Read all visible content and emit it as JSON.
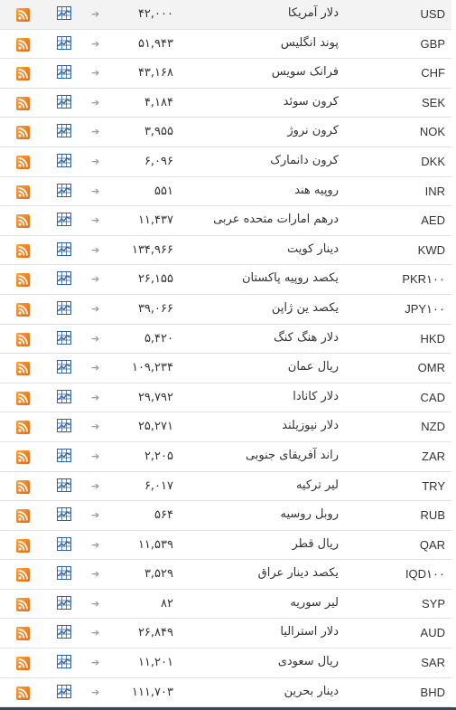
{
  "colors": {
    "rss": "#ef7d1d",
    "chart_icon": "#2f5f9e",
    "row_highlight": "#f3f3f3",
    "bottom_bar": "#3a4652"
  },
  "icons": {
    "rss": "rss-feed-icon",
    "chart": "chart-icon",
    "trend": "arrow-right-icon"
  },
  "trend_glyph": "➔",
  "rows": [
    {
      "code": "USD",
      "name": "دلار آمریکا",
      "value": "۴۲,۰۰۰"
    },
    {
      "code": "GBP",
      "name": "پوند انگلیس",
      "value": "۵۱,۹۴۳"
    },
    {
      "code": "CHF",
      "name": "فرانک سویس",
      "value": "۴۳,۱۶۸"
    },
    {
      "code": "SEK",
      "name": "کرون سوئد",
      "value": "۴,۱۸۴"
    },
    {
      "code": "NOK",
      "name": "کرون نروژ",
      "value": "۳,۹۵۵"
    },
    {
      "code": "DKK",
      "name": "کرون دانمارک",
      "value": "۶,۰۹۶"
    },
    {
      "code": "INR",
      "name": "روپیه هند",
      "value": "۵۵۱"
    },
    {
      "code": "AED",
      "name": "درهم امارات متحده عربی",
      "value": "۱۱,۴۳۷"
    },
    {
      "code": "KWD",
      "name": "دینار کویت",
      "value": "۱۳۴,۹۶۶"
    },
    {
      "code": "PKR۱۰۰",
      "name": "یکصد روپیه پاکستان",
      "value": "۲۶,۱۵۵"
    },
    {
      "code": "JPY۱۰۰",
      "name": "یکصد ین ژاپن",
      "value": "۳۹,۰۶۶"
    },
    {
      "code": "HKD",
      "name": "دلار هنگ کنگ",
      "value": "۵,۴۲۰"
    },
    {
      "code": "OMR",
      "name": "ریال عمان",
      "value": "۱۰۹,۲۳۴"
    },
    {
      "code": "CAD",
      "name": "دلار کانادا",
      "value": "۲۹,۷۹۲"
    },
    {
      "code": "NZD",
      "name": "دلار نیوزیلند",
      "value": "۲۵,۲۷۱"
    },
    {
      "code": "ZAR",
      "name": "راند آفریقای جنوبی",
      "value": "۲,۲۰۵"
    },
    {
      "code": "TRY",
      "name": "لیر ترکیه",
      "value": "۶,۰۱۷"
    },
    {
      "code": "RUB",
      "name": "روبل روسیه",
      "value": "۵۶۴"
    },
    {
      "code": "QAR",
      "name": "ریال قطر",
      "value": "۱۱,۵۳۹"
    },
    {
      "code": "IQD۱۰۰",
      "name": "یکصد دینار عراق",
      "value": "۳,۵۲۹"
    },
    {
      "code": "SYP",
      "name": "لیر سوریه",
      "value": "۸۲"
    },
    {
      "code": "AUD",
      "name": "دلار استرالیا",
      "value": "۲۶,۸۴۹"
    },
    {
      "code": "SAR",
      "name": "ریال سعودی",
      "value": "۱۱,۲۰۱"
    },
    {
      "code": "BHD",
      "name": "دینار بحرین",
      "value": "۱۱۱,۷۰۳"
    }
  ]
}
